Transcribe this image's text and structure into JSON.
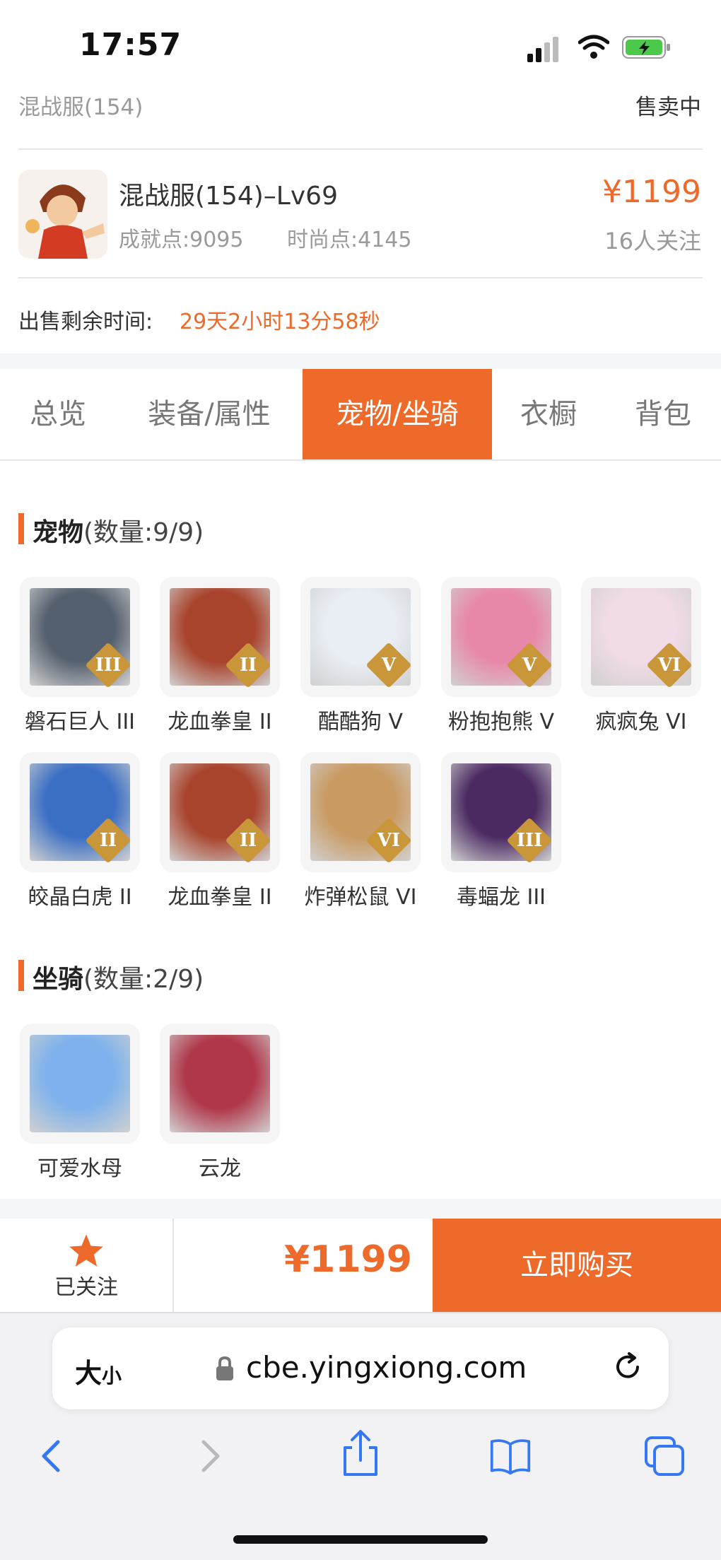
{
  "status_bar": {
    "time": "17:57"
  },
  "header": {
    "server": "混战服(154)",
    "sale_status": "售卖中"
  },
  "listing": {
    "title": "混战服(154)–Lv69",
    "achievement": "成就点:9095",
    "fashion": "时尚点:4145",
    "price": "¥1199",
    "followers": "16人关注",
    "remaining_label": "出售剩余时间:",
    "remaining_value": "29天2小时13分58秒"
  },
  "tabs": [
    {
      "label": "总览",
      "active": false
    },
    {
      "label": "装备/属性",
      "active": false
    },
    {
      "label": "宠物/坐骑",
      "active": true
    },
    {
      "label": "衣橱",
      "active": false
    },
    {
      "label": "背包",
      "active": false
    }
  ],
  "pets": {
    "title": "宠物",
    "count": "(数量:9/9)",
    "items": [
      {
        "name": "磐石巨人 III",
        "grade": "III",
        "color": "#55606e"
      },
      {
        "name": "龙血拳皇 II",
        "grade": "II",
        "color": "#a8432c"
      },
      {
        "name": "酷酷狗 V",
        "grade": "V",
        "color": "#e9eef5"
      },
      {
        "name": "粉抱抱熊 V",
        "grade": "V",
        "color": "#e888a8"
      },
      {
        "name": "疯疯兔 VI",
        "grade": "VI",
        "color": "#f1dbe6"
      },
      {
        "name": "皎晶白虎 II",
        "grade": "II",
        "color": "#3b6fc4"
      },
      {
        "name": "龙血拳皇 II",
        "grade": "II",
        "color": "#a8432c"
      },
      {
        "name": "炸弹松鼠 VI",
        "grade": "VI",
        "color": "#c99a62"
      },
      {
        "name": "毒蝠龙 III",
        "grade": "III",
        "color": "#4b2a62"
      }
    ]
  },
  "mounts": {
    "title": "坐骑",
    "count": "(数量:2/9)",
    "items": [
      {
        "name": "可爱水母",
        "color": "#7fb2ec"
      },
      {
        "name": "云龙",
        "color": "#b0374a"
      }
    ]
  },
  "bottom_bar": {
    "follow_label": "已关注",
    "price": "¥1199",
    "buy_label": "立即购买"
  },
  "browser": {
    "text_size_big": "大",
    "text_size_small": "小",
    "url": "cbe.yingxiong.com"
  },
  "colors": {
    "accent": "#ee6a2a",
    "badge": "#c9963a"
  }
}
